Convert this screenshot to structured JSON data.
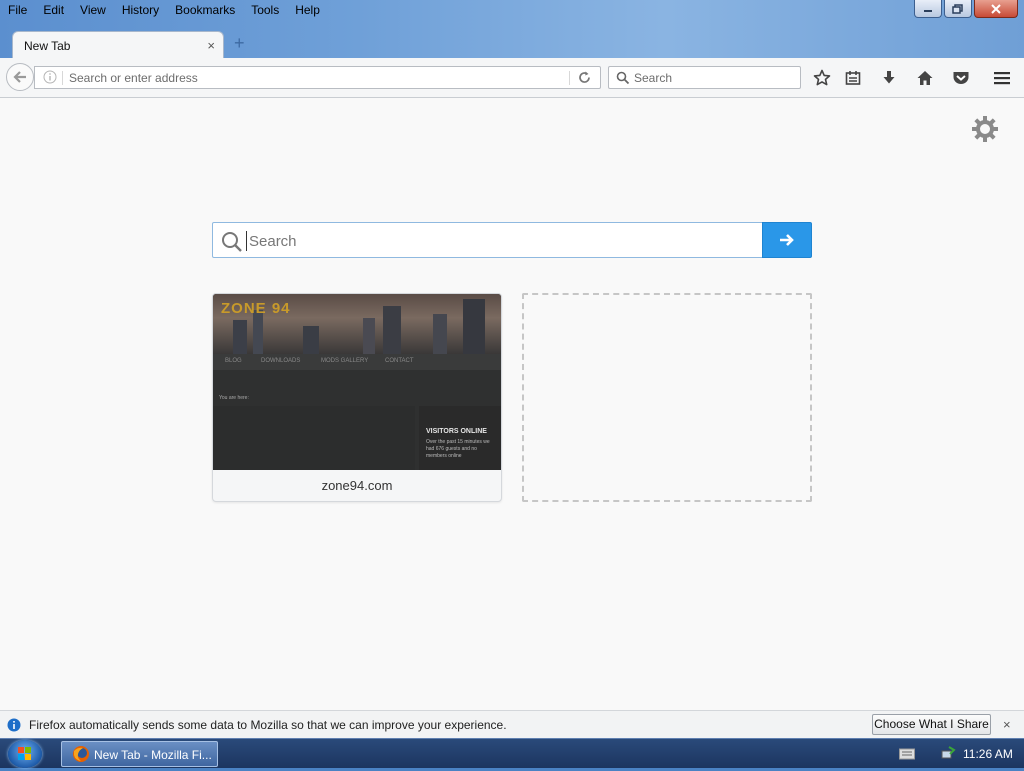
{
  "menu": {
    "items": [
      {
        "label": "File"
      },
      {
        "label": "Edit"
      },
      {
        "label": "View"
      },
      {
        "label": "History"
      },
      {
        "label": "Bookmarks"
      },
      {
        "label": "Tools"
      },
      {
        "label": "Help"
      }
    ]
  },
  "tab": {
    "title": "New Tab",
    "close": "×",
    "new_tab": "+"
  },
  "navbar": {
    "url_placeholder": "Search or enter address",
    "search_placeholder": "Search"
  },
  "newtab": {
    "search_placeholder": "Search",
    "tiles": [
      {
        "title": "zone94.com",
        "thumb_logo": "ZONE 94",
        "thumb_nav": [
          "BLOG",
          "DOWNLOADS",
          "MODS GALLERY",
          "CONTACT"
        ],
        "thumb_crumb": "You are here:",
        "thumb_widget_title": "VISITORS ONLINE",
        "thumb_widget_text": "Over the past 15 minutes we had 676 guests and no members online"
      }
    ]
  },
  "notification": {
    "text": "Firefox automatically sends some data to Mozilla so that we can improve your experience.",
    "button": "Choose What I Share",
    "close": "×"
  },
  "taskbar": {
    "window_label": "New Tab - Mozilla Fi...",
    "clock": "11:26 AM"
  },
  "colors": {
    "accent": "#2a97e8",
    "info_blue": "#1e6ec8"
  }
}
